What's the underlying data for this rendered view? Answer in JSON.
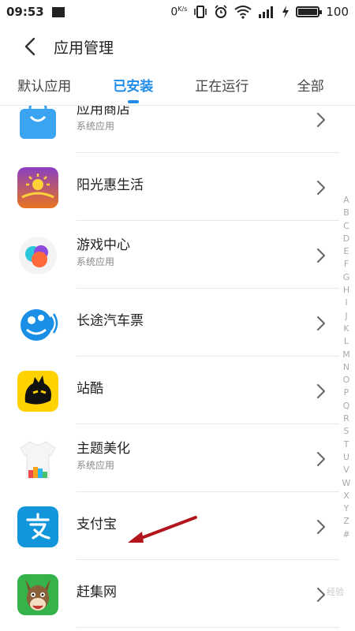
{
  "status_bar": {
    "time": "09:53",
    "net_speed": "0",
    "net_unit": "K/s",
    "battery_percent": "100"
  },
  "header": {
    "title": "应用管理"
  },
  "tabs": [
    {
      "label": "默认应用",
      "active": false
    },
    {
      "label": "已安装",
      "active": true
    },
    {
      "label": "正在运行",
      "active": false
    },
    {
      "label": "全部",
      "active": false
    }
  ],
  "apps": [
    {
      "name": "应用商店",
      "sub": "系统应用"
    },
    {
      "name": "阳光惠生活",
      "sub": ""
    },
    {
      "name": "游戏中心",
      "sub": "系统应用"
    },
    {
      "name": "长途汽车票",
      "sub": ""
    },
    {
      "name": "站酷",
      "sub": ""
    },
    {
      "name": "主题美化",
      "sub": "系统应用"
    },
    {
      "name": "支付宝",
      "sub": ""
    },
    {
      "name": "赶集网",
      "sub": ""
    }
  ],
  "index_letters": [
    "A",
    "B",
    "C",
    "D",
    "E",
    "F",
    "G",
    "H",
    "I",
    "J",
    "K",
    "L",
    "M",
    "N",
    "O",
    "P",
    "Q",
    "R",
    "S",
    "T",
    "U",
    "V",
    "W",
    "X",
    "Y",
    "Z",
    "#"
  ],
  "watermark": "经验",
  "colors": {
    "accent": "#1e8ce8",
    "arrow": "#b3151d",
    "alipay": "#1296db",
    "zcool": "#ffd200"
  }
}
